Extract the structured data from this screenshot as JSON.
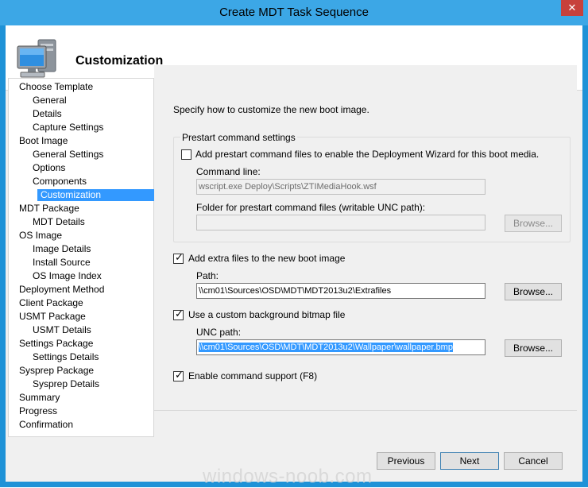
{
  "window": {
    "title": "Create MDT Task Sequence",
    "close_glyph": "✕"
  },
  "header": {
    "title": "Customization",
    "icon": "computer-icon"
  },
  "nav": {
    "items": [
      {
        "label": "Choose Template"
      },
      {
        "label": "General"
      },
      {
        "label": "Details"
      },
      {
        "label": "Capture Settings"
      },
      {
        "label": "Boot Image"
      },
      {
        "label": "General Settings"
      },
      {
        "label": "Options"
      },
      {
        "label": "Components"
      },
      {
        "label": "Customization"
      },
      {
        "label": "MDT Package"
      },
      {
        "label": "MDT Details"
      },
      {
        "label": "OS Image"
      },
      {
        "label": "Image Details"
      },
      {
        "label": "Install Source"
      },
      {
        "label": "OS Image Index"
      },
      {
        "label": "Deployment Method"
      },
      {
        "label": "Client Package"
      },
      {
        "label": "USMT Package"
      },
      {
        "label": "USMT Details"
      },
      {
        "label": "Settings Package"
      },
      {
        "label": "Settings Details"
      },
      {
        "label": "Sysprep Package"
      },
      {
        "label": "Sysprep Details"
      },
      {
        "label": "Summary"
      },
      {
        "label": "Progress"
      },
      {
        "label": "Confirmation"
      }
    ],
    "selected": "Customization"
  },
  "main": {
    "instruction": "Specify how to customize the new boot image.",
    "prestart": {
      "group_label": "Prestart command settings",
      "enable_label": "Add prestart command files to enable the Deployment Wizard for this boot media.",
      "enable_checked": false,
      "command_line_label": "Command line:",
      "command_line_value": "wscript.exe Deploy\\Scripts\\ZTIMediaHook.wsf",
      "folder_label": "Folder for prestart command files (writable UNC path):",
      "folder_value": "",
      "browse_label": "Browse..."
    },
    "extra_files": {
      "label": "Add extra files to the new boot image",
      "checked": true,
      "path_label": "Path:",
      "path_value": "\\\\cm01\\Sources\\OSD\\MDT\\MDT2013u2\\Extrafiles",
      "browse_label": "Browse..."
    },
    "background": {
      "label": "Use a custom background bitmap file",
      "checked": true,
      "unc_label": "UNC path:",
      "unc_value": "\\\\cm01\\Sources\\OSD\\MDT\\MDT2013u2\\Wallpaper\\wallpaper.bmp",
      "browse_label": "Browse..."
    },
    "command_support": {
      "label": "Enable command support (F8)",
      "checked": true
    }
  },
  "footer": {
    "previous_label": "Previous",
    "next_label": "Next",
    "cancel_label": "Cancel"
  },
  "watermark": "windows-noob.com"
}
